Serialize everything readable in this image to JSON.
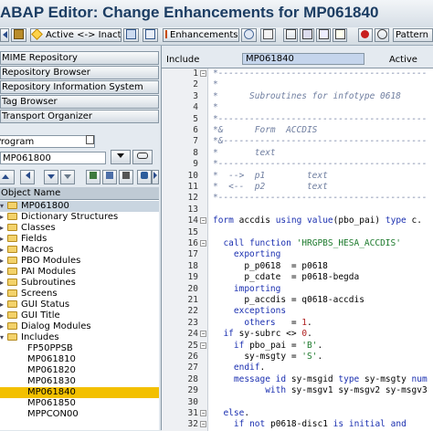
{
  "window": {
    "title": "ABAP Editor: Change Enhancements for MP061840"
  },
  "toolbar": {
    "active_inactive_label": "Active <-> Inactive",
    "enhancements_label": "Enhancements",
    "pattern_label": "Pattern"
  },
  "navigator": {
    "buttons": [
      "MIME Repository",
      "Repository Browser",
      "Repository Information System",
      "Tag Browser",
      "Transport Organizer"
    ],
    "object_type": "Program",
    "object_name": "MP061800",
    "column_header": "Object Name"
  },
  "tree": {
    "root": "MP061800",
    "folders": [
      "Dictionary Structures",
      "Classes",
      "Fields",
      "Macros",
      "PBO Modules",
      "PAI Modules",
      "Subroutines",
      "Screens",
      "GUI Status",
      "GUI Title",
      "Dialog Modules",
      "Includes"
    ],
    "includes": [
      "FP50PPSB",
      "MP061810",
      "MP061820",
      "MP061830",
      "MP061840",
      "MP061850",
      "MPPCON00"
    ],
    "selected": "MP061840"
  },
  "editor": {
    "include_label": "Include",
    "include_value": "MP061840",
    "status": "Active",
    "lines": [
      {
        "n": "1",
        "t": "*----------------------------------------",
        "k": "comment"
      },
      {
        "n": "2",
        "t": "*",
        "k": "comment"
      },
      {
        "n": "3",
        "t": "*      Subroutines for infotype 0618",
        "k": "comment"
      },
      {
        "n": "4",
        "t": "*",
        "k": "comment"
      },
      {
        "n": "5",
        "t": "*----------------------------------------",
        "k": "comment"
      },
      {
        "n": "6",
        "t": "*&      Form  ACCDIS",
        "k": "comment"
      },
      {
        "n": "7",
        "t": "*&---------------------------------------",
        "k": "comment"
      },
      {
        "n": "8",
        "t": "*       text",
        "k": "comment"
      },
      {
        "n": "9",
        "t": "*----------------------------------------",
        "k": "comment"
      },
      {
        "n": "10",
        "t": "*  -->  p1        text",
        "k": "comment"
      },
      {
        "n": "11",
        "t": "*  <--  p2        text",
        "k": "comment"
      },
      {
        "n": "12",
        "t": "*----------------------------------------",
        "k": "comment"
      },
      {
        "n": "13",
        "t": "",
        "k": "plain"
      },
      {
        "n": "14",
        "t": "form accdis using value(pbo_pai) type c.",
        "k": "kw"
      },
      {
        "n": "15",
        "t": "",
        "k": "plain"
      },
      {
        "n": "16",
        "t": "  call function 'HRGPBS_HESA_ACCDIS'",
        "k": "mixed16"
      },
      {
        "n": "17",
        "t": "    exporting",
        "k": "kw"
      },
      {
        "n": "18",
        "t": "      p_p0618  = p0618",
        "k": "plain"
      },
      {
        "n": "19",
        "t": "      p_cdate  = p0618-begda",
        "k": "plain"
      },
      {
        "n": "20",
        "t": "    importing",
        "k": "kw"
      },
      {
        "n": "21",
        "t": "      p_accdis = q0618-accdis",
        "k": "plain"
      },
      {
        "n": "22",
        "t": "    exceptions",
        "k": "kw"
      },
      {
        "n": "23",
        "t": "      others   = 1.",
        "k": "mixed23"
      },
      {
        "n": "24",
        "t": "  if sy-subrc <> 0.",
        "k": "mixed24"
      },
      {
        "n": "25",
        "t": "    if pbo_pai = 'B'.",
        "k": "mixed25"
      },
      {
        "n": "26",
        "t": "      sy-msgty = 'S'.",
        "k": "mixed26"
      },
      {
        "n": "27",
        "t": "    endif.",
        "k": "kw"
      },
      {
        "n": "28",
        "t": "    message id sy-msgid type sy-msgty num",
        "k": "kw"
      },
      {
        "n": "29",
        "t": "          with sy-msgv1 sy-msgv2 sy-msgv3",
        "k": "kw"
      },
      {
        "n": "30",
        "t": "",
        "k": "plain"
      },
      {
        "n": "31",
        "t": "  else.",
        "k": "kw"
      },
      {
        "n": "32",
        "t": "    if not p0618-disc1 is initial and",
        "k": "kw"
      }
    ]
  },
  "colors": {
    "title": "#1c3d63",
    "selection": "#f3c000",
    "keyword": "#1a2fb0",
    "string": "#1c7a2c",
    "comment": "#6f7ea0"
  }
}
